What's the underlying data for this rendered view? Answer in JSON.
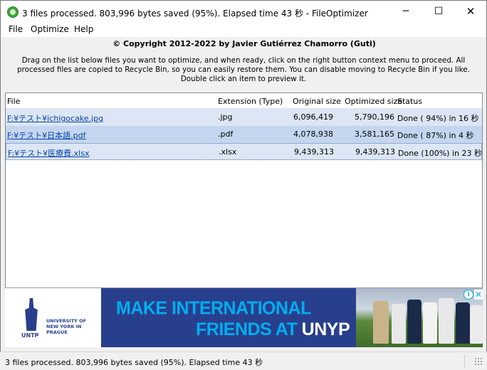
{
  "window": {
    "title": "3 files processed. 803,996 bytes saved (95%). Elapsed time  43 秒 - FileOptimizer",
    "minimize_glyph": "─",
    "maximize_glyph": "☐",
    "close_glyph": "✕"
  },
  "menu": [
    "File",
    "Optimize",
    "Help"
  ],
  "copyright": "© Copyright 2012-2022 by Javier Gutiérrez Chamorro (Guti)",
  "instructions": "Drag on the list below files you want to optimize, and when ready, click on the right button context menu to proceed. All processed files are copied to Recycle Bin, so you can easily restore them. You can disable moving to Recycle Bin if you like. Double click an item to preview it.",
  "table": {
    "columns": [
      "File",
      "Extension (Type)",
      "Original size",
      "Optimized size",
      "Status"
    ],
    "rows": [
      {
        "file": "F:¥テスト¥ichigocake.jpg",
        "ext": ".jpg",
        "original": "6,096,419",
        "optimized": "5,790,196",
        "status": "Done ( 94%) in  16 秒"
      },
      {
        "file": "F:¥テスト¥日本語.pdf",
        "ext": ".pdf",
        "original": "4,078,938",
        "optimized": "3,581,165",
        "status": "Done ( 87%) in  4 秒"
      },
      {
        "file": "F:¥テスト¥医療費.xlsx",
        "ext": ".xlsx",
        "original": "9,439,313",
        "optimized": "9,439,313",
        "status": "Done (100%) in  23 秒"
      }
    ]
  },
  "ad": {
    "logo_abbr": "UNTP",
    "logo_name": "UNIVERSITY OF NEW YORK IN PRAGUE",
    "headline1": "MAKE INTERNATIONAL",
    "headline2a": "FRIENDS AT ",
    "headline2b": "UNYP",
    "info_glyph": "i",
    "close_glyph": "✕",
    "colors": {
      "background": "#283f8d",
      "accent": "#00aeef"
    }
  },
  "statusbar": {
    "text": "3 files processed. 803,996 bytes saved (95%). Elapsed time  43 秒"
  },
  "icons": {
    "app": "fileoptimizer-icon",
    "grip": "resize-grip-icon"
  }
}
